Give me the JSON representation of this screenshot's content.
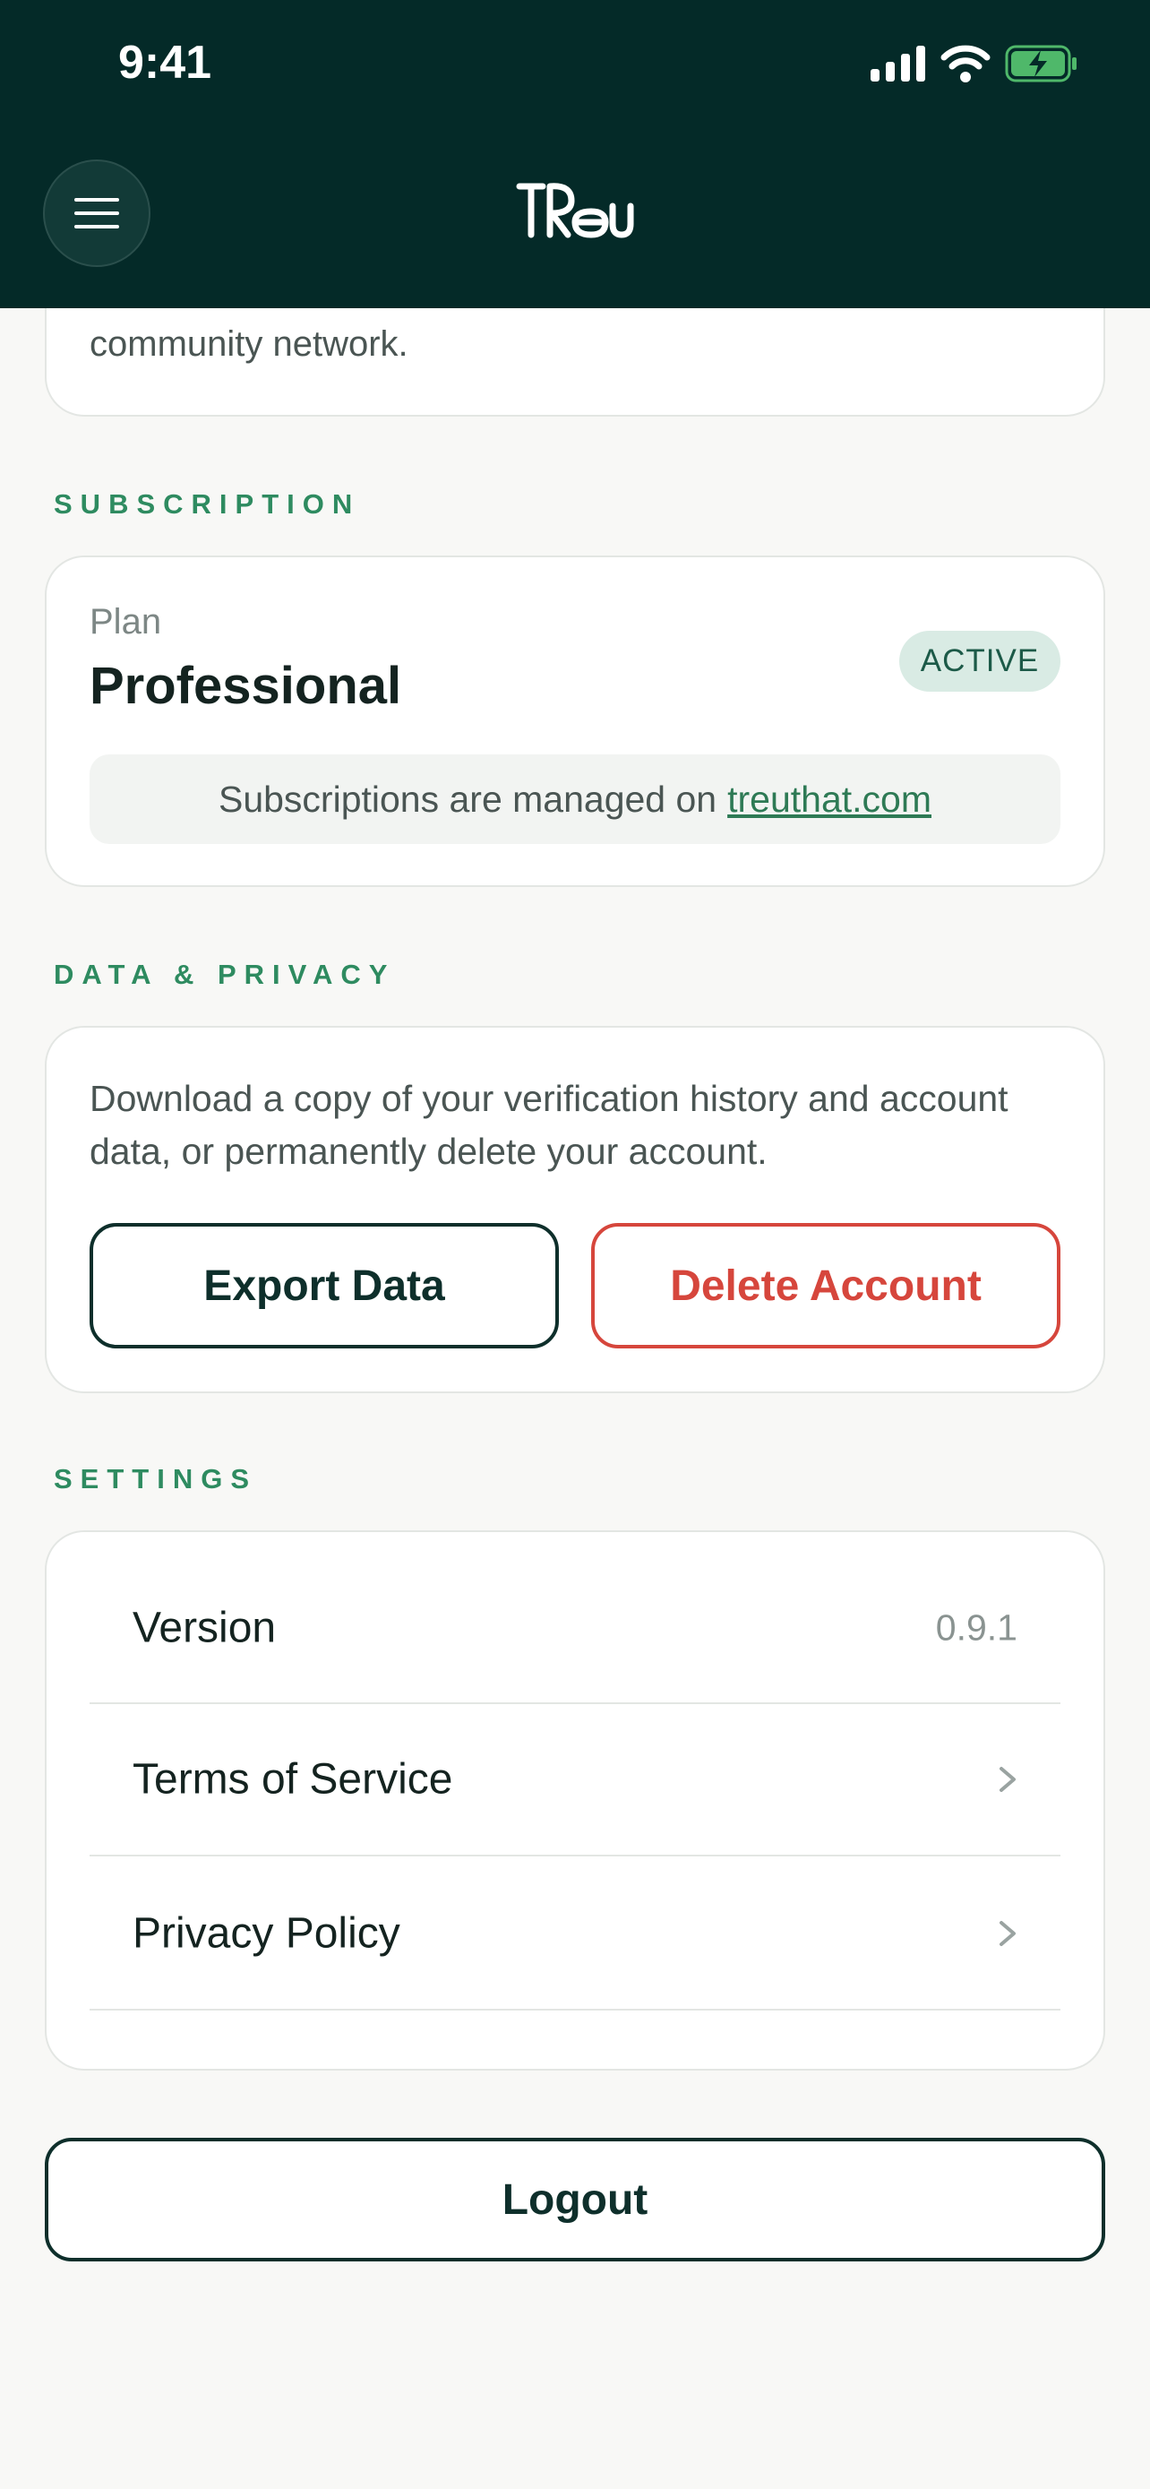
{
  "status_bar": {
    "time": "9:41"
  },
  "top_card": {
    "text": "community network."
  },
  "subscription": {
    "section_label": "SUBSCRIPTION",
    "plan_label": "Plan",
    "plan_name": "Professional",
    "badge": "ACTIVE",
    "managed_text": "Subscriptions are managed on",
    "managed_link": "treuthat.com"
  },
  "data_privacy": {
    "section_label": "DATA & PRIVACY",
    "description": "Download a copy of your verification history and account data, or permanently delete your account.",
    "export_label": "Export Data",
    "delete_label": "Delete Account"
  },
  "settings": {
    "section_label": "SETTINGS",
    "rows": [
      {
        "label": "Version",
        "value": "0.9.1"
      },
      {
        "label": "Terms of Service"
      },
      {
        "label": "Privacy Policy"
      }
    ]
  },
  "logout_label": "Logout",
  "icons": {
    "menu": "hamburger-menu-icon",
    "chevron": "chevron-right-icon",
    "signal": "cellular-signal-icon",
    "wifi": "wifi-icon",
    "battery": "battery-charging-icon"
  },
  "colors": {
    "header_bg": "#042a28",
    "accent_green": "#2e8b60",
    "danger_red": "#d6463c",
    "dark_teal": "#0e2f2b"
  }
}
